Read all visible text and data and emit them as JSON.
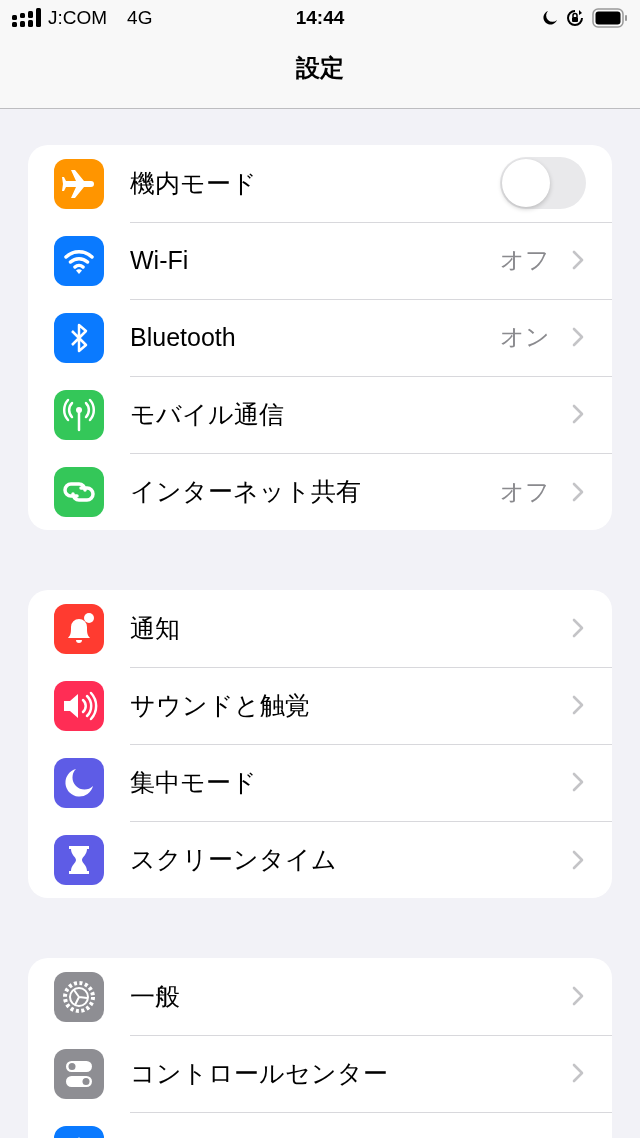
{
  "status_bar": {
    "carrier": "J:COM",
    "network": "4G",
    "time": "14:44"
  },
  "nav": {
    "title": "設定"
  },
  "groups": [
    {
      "rows": [
        {
          "kind": "toggle",
          "label": "機内モード",
          "on": false,
          "color": "#ff9500"
        },
        {
          "kind": "link",
          "label": "Wi-Fi",
          "value": "オフ",
          "color": "#0a7aff"
        },
        {
          "kind": "link",
          "label": "Bluetooth",
          "value": "オン",
          "color": "#0a7aff"
        },
        {
          "kind": "link",
          "label": "モバイル通信",
          "color": "#34c759"
        },
        {
          "kind": "link",
          "label": "インターネット共有",
          "value": "オフ",
          "color": "#34c759"
        }
      ]
    },
    {
      "rows": [
        {
          "kind": "link",
          "label": "通知",
          "color": "#ff3b30"
        },
        {
          "kind": "link",
          "label": "サウンドと触覚",
          "color": "#ff2d55"
        },
        {
          "kind": "link",
          "label": "集中モード",
          "color": "#5e5ce6"
        },
        {
          "kind": "link",
          "label": "スクリーンタイム",
          "color": "#5e5ce6"
        }
      ]
    },
    {
      "rows": [
        {
          "kind": "link",
          "label": "一般",
          "color": "#8e8e93"
        },
        {
          "kind": "link",
          "label": "コントロールセンター",
          "color": "#8e8e93"
        },
        {
          "kind": "link",
          "color": "#0a7aff"
        }
      ]
    }
  ]
}
